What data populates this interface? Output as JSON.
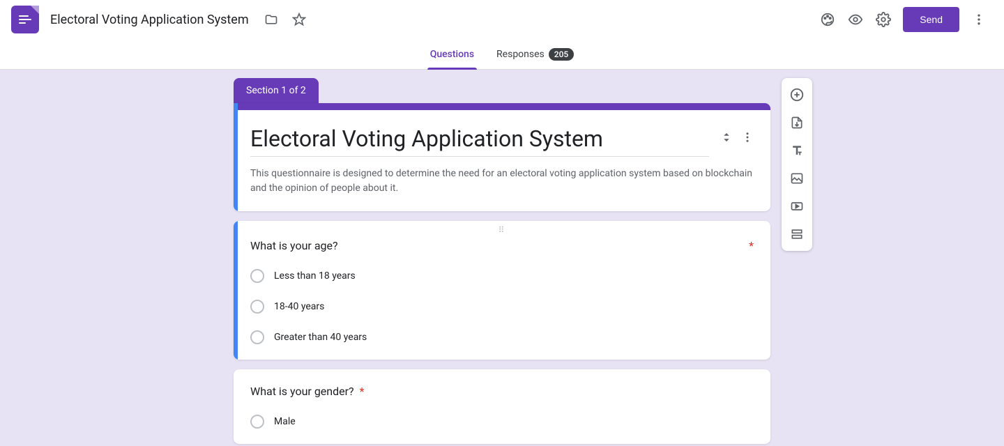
{
  "header": {
    "title": "Electoral Voting Application System",
    "send_label": "Send"
  },
  "tabs": {
    "questions": "Questions",
    "responses": "Responses",
    "response_count": "205"
  },
  "section_label": "Section 1 of 2",
  "form": {
    "title": "Electoral Voting Application System",
    "description": "This questionnaire is designed to determine the need for an electoral voting application system based on blockchain and the opinion of people about it."
  },
  "questions": [
    {
      "text": "What is your age?",
      "required": true,
      "options": [
        "Less than 18 years",
        "18-40 years",
        "Greater than 40 years"
      ]
    },
    {
      "text": "What is your gender?",
      "required": true,
      "options": [
        "Male"
      ]
    }
  ]
}
